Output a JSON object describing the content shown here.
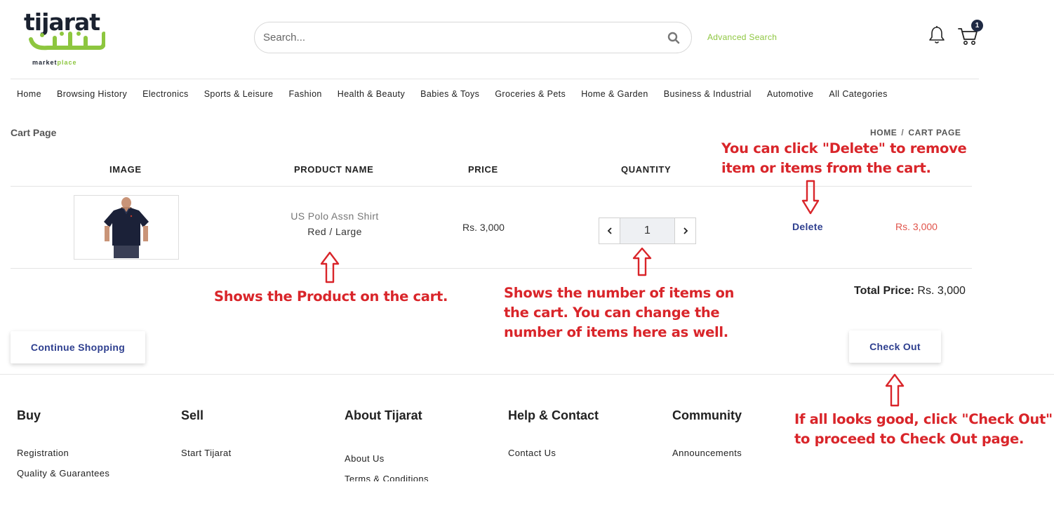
{
  "header": {
    "logo_text": "tijarat",
    "logo_sub_a": "market",
    "logo_sub_b": "place",
    "search_placeholder": "Search...",
    "advanced_search": "Advanced Search",
    "cart_count": "1"
  },
  "nav": {
    "items": [
      "Home",
      "Browsing History",
      "Electronics",
      "Sports & Leisure",
      "Fashion",
      "Health & Beauty",
      "Babies & Toys",
      "Groceries & Pets",
      "Home & Garden",
      "Business & Industrial",
      "Automotive",
      "All Categories"
    ]
  },
  "cart": {
    "page_title": "Cart Page",
    "breadcrumb": [
      "HOME",
      "CART PAGE"
    ],
    "columns": [
      "IMAGE",
      "PRODUCT NAME",
      "PRICE",
      "QUANTITY"
    ],
    "item": {
      "name": "US Polo Assn Shirt",
      "variant": "Red / Large",
      "price": "Rs. 3,000",
      "quantity": "1",
      "delete_label": "Delete",
      "subtotal": "Rs. 3,000"
    },
    "total_label": "Total Price:",
    "total_value": "Rs. 3,000",
    "continue_label": "Continue Shopping",
    "checkout_label": "Check Out"
  },
  "footer": {
    "columns": [
      {
        "title": "Buy",
        "links": [
          "Registration",
          "Quality & Guarantees"
        ]
      },
      {
        "title": "Sell",
        "links": [
          "Start Tijarat"
        ]
      },
      {
        "title": "About Tijarat",
        "links": [
          "About Us",
          "Terms & Conditions"
        ]
      },
      {
        "title": "Help & Contact",
        "links": [
          "Contact Us"
        ]
      },
      {
        "title": "Community",
        "links": [
          "Announcements"
        ]
      }
    ]
  },
  "annotations": {
    "delete_note_1": "You can click \"Delete\" to remove",
    "delete_note_2": "item or items from the cart.",
    "product_note": "Shows the Product on the cart.",
    "qty_note_1": "Shows the number of items on",
    "qty_note_2": "the cart. You can change the",
    "qty_note_3": "number of items here as well.",
    "checkout_note_1": "If all looks good, click \"Check Out\"",
    "checkout_note_2": "to proceed to Check Out page."
  },
  "colors": {
    "brand_green": "#8dc63f",
    "brand_dark": "#1b2230",
    "link_blue": "#2e3f8f",
    "price_red": "#e0534a",
    "annotation_red": "#d9252a"
  }
}
